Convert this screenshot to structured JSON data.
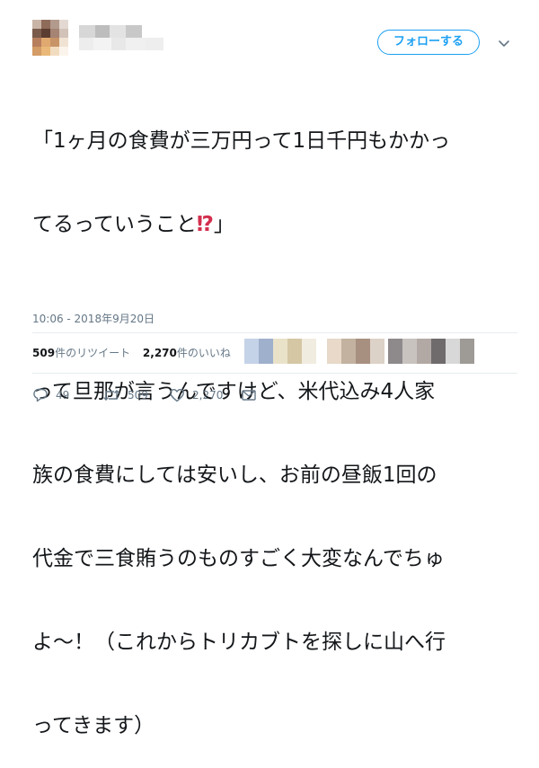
{
  "tweet": {
    "follow_label": "フォローする",
    "text_lines_1": [
      "「1ヶ月の食費が三万円って1日千円もかかっ",
      "てるっていうこと"
    ],
    "text_emoji": "⁉",
    "text_close": "」",
    "text_para2": [
      "って旦那が言うんですけど、米代込み4人家",
      "族の食費にしては安いし、お前の昼飯1回の",
      "代金で三食賄うのものすごく大変なんでちゅ",
      "よ〜！（これからトリカブトを探しに山へ行",
      "ってきます）"
    ],
    "timestamp": "10:06 - 2018年9月20日",
    "retweet_count_num": "509",
    "retweet_count_label": "件のリツイート",
    "like_count_num": "2,270",
    "like_count_label": "件のいいね",
    "actions": {
      "reply_count": "49",
      "retweet_count": "509",
      "like_count": "2,270"
    }
  },
  "icons": [
    "reply-icon",
    "retweet-icon",
    "like-icon",
    "dm-icon",
    "chevron-down-icon"
  ],
  "colors": {
    "accent": "#1da1f2",
    "text": "#14171a",
    "muted": "#657786",
    "divider": "#e6ecf0",
    "emoji": "#d32f4e"
  }
}
